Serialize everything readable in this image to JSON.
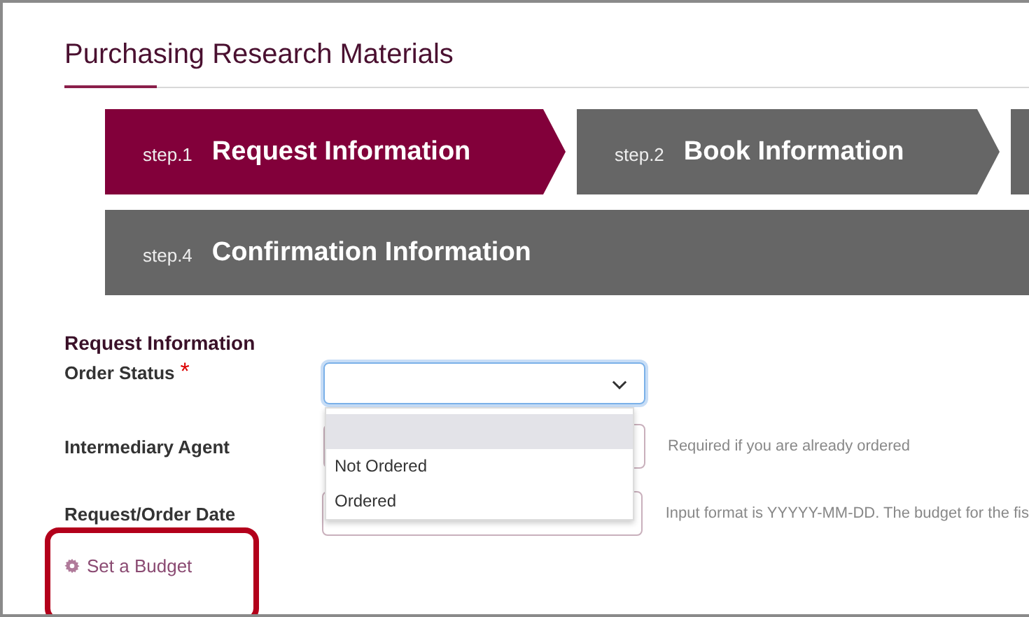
{
  "page": {
    "title": "Purchasing Research Materials"
  },
  "steps": [
    {
      "number": "step.1",
      "label": "Request Information",
      "selected": true
    },
    {
      "number": "step.2",
      "label": "Book Information",
      "selected": false
    },
    {
      "selected": false
    },
    {
      "number": "step.4",
      "label": "Confirmation Information",
      "selected": false
    }
  ],
  "section": {
    "title": "Request Information"
  },
  "fields": [
    {
      "kind": "select",
      "label": "Order Status",
      "required_mark": "*",
      "focused": true,
      "expanded": true,
      "options": [
        {
          "selected": true
        },
        {
          "label": "Not Ordered",
          "selected": false
        },
        {
          "label": "Ordered",
          "selected": false
        }
      ]
    },
    {
      "kind": "text",
      "label": "Intermediary Agent",
      "hint": "Required if you are already ordered"
    },
    {
      "kind": "text",
      "label": "Request/Order Date",
      "hint": "Input format is YYYYY-MM-DD. The budget for the fis"
    }
  ],
  "budget_link": {
    "label": "Set a Budget",
    "highlighted": true
  }
}
